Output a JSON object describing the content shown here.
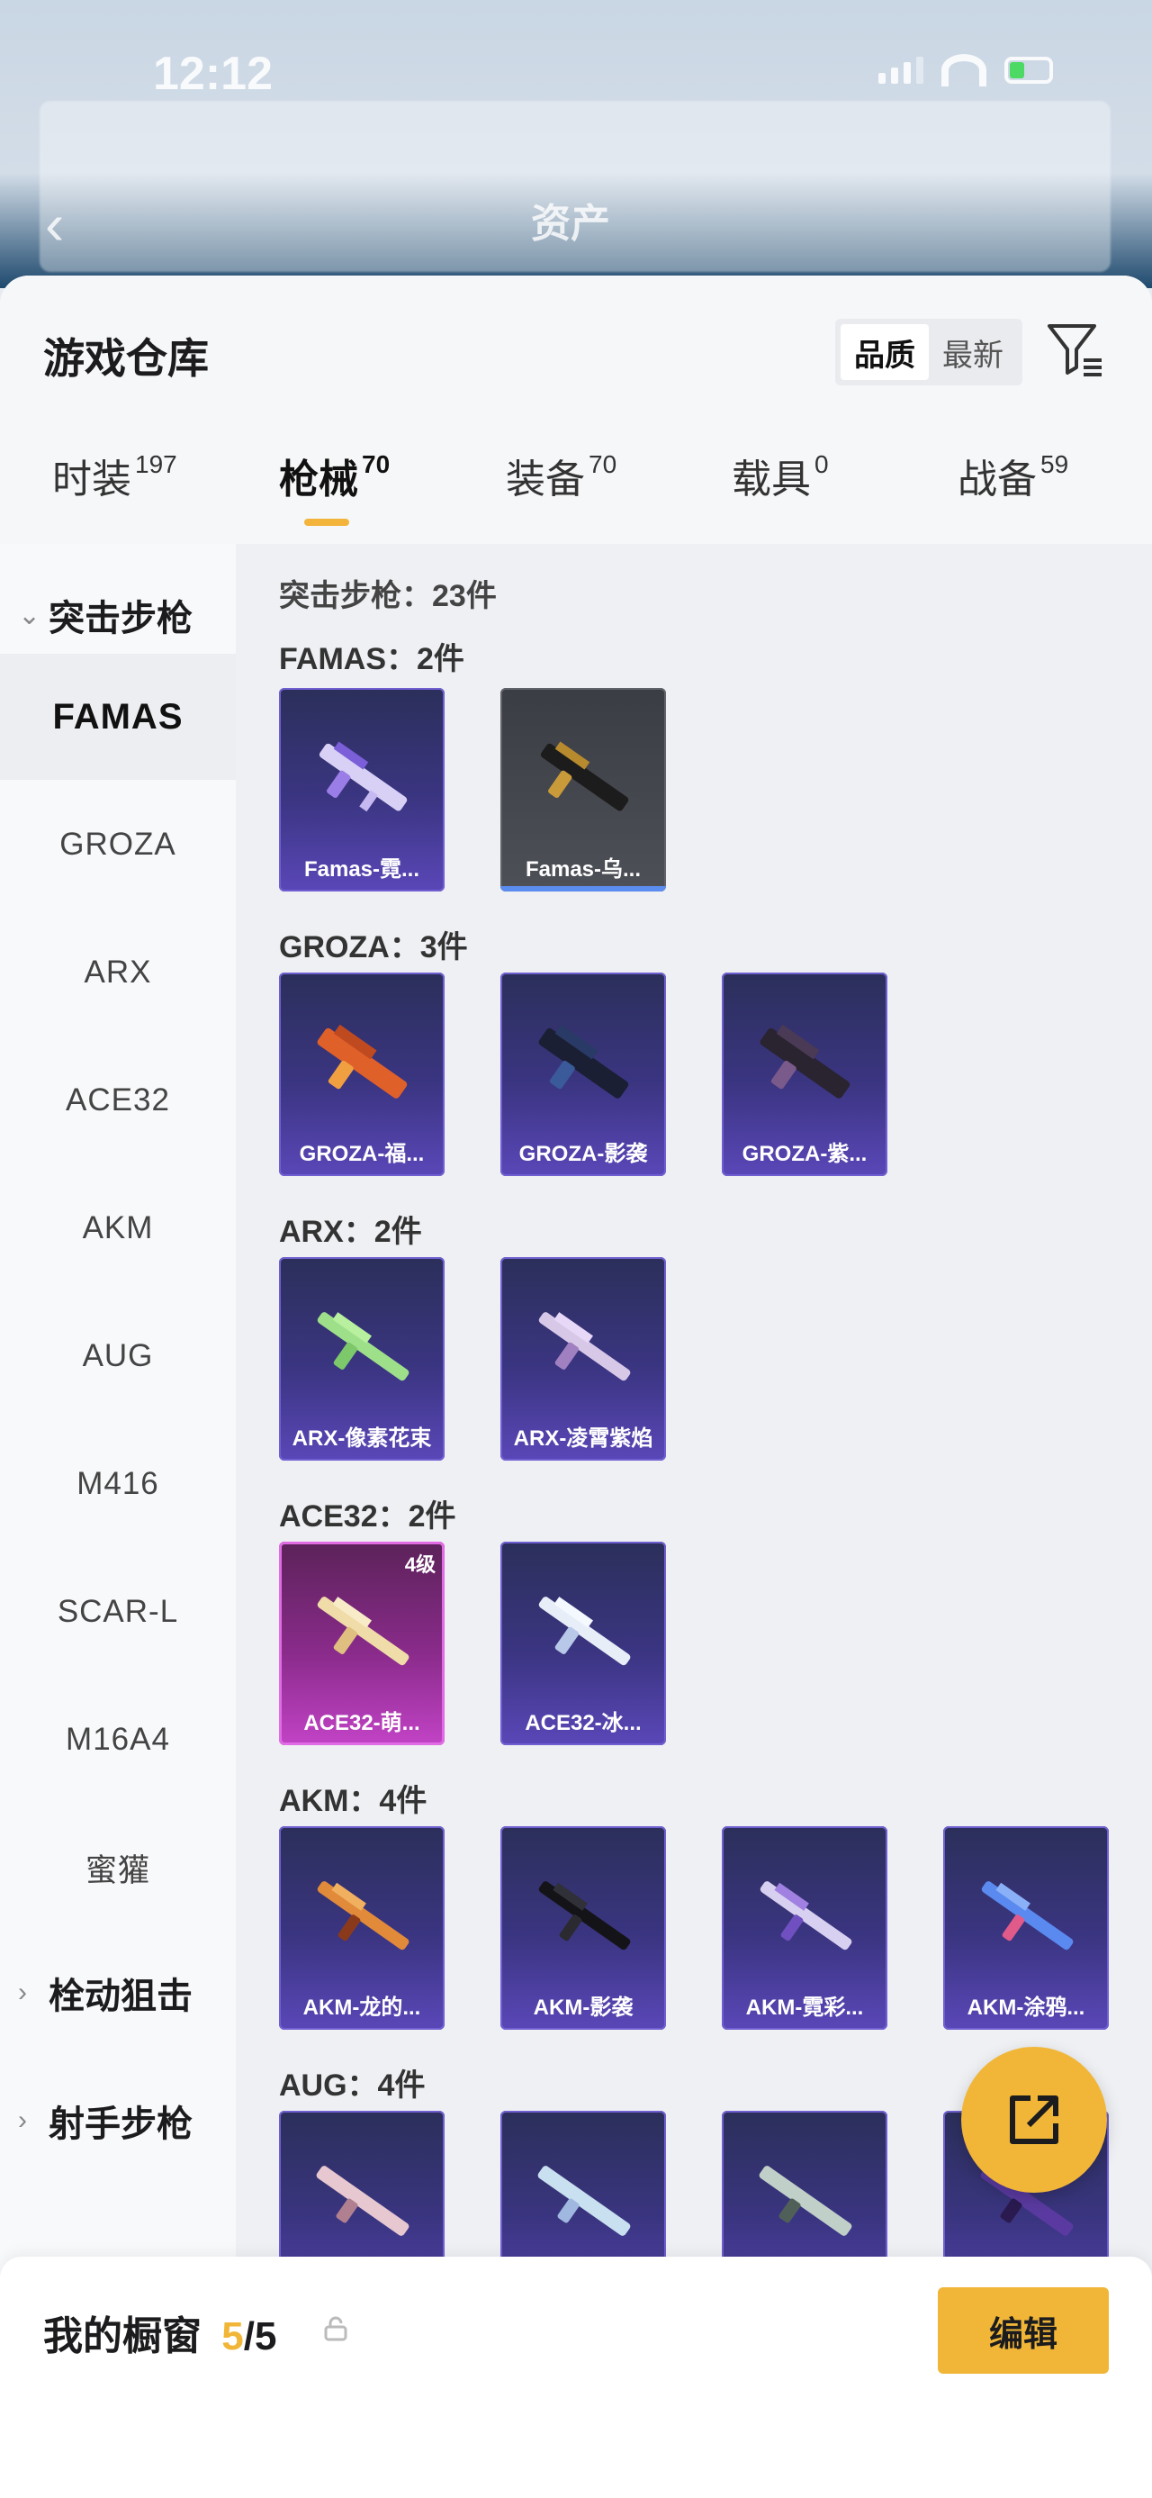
{
  "status_bar": {
    "time": "12:12"
  },
  "header": {
    "title": "资产"
  },
  "sheet": {
    "title": "游戏仓库",
    "sort": {
      "quality": "品质",
      "newest": "最新",
      "active": "quality"
    }
  },
  "tabs": [
    {
      "label": "时装",
      "count": "197"
    },
    {
      "label": "枪械",
      "count": "70",
      "active": true
    },
    {
      "label": "装备",
      "count": "70"
    },
    {
      "label": "载具",
      "count": "0"
    },
    {
      "label": "战备",
      "count": "59"
    }
  ],
  "sidebar": {
    "group_assault": "突击步枪",
    "items": [
      "FAMAS",
      "GROZA",
      "ARX",
      "ACE32",
      "AKM",
      "AUG",
      "M416",
      "SCAR-L",
      "M16A4",
      "蜜獾"
    ],
    "active_item": "FAMAS",
    "group_bolt": "栓动狙击",
    "group_marksman": "射手步枪"
  },
  "content": {
    "header": "突击步枪：23件",
    "sections": [
      {
        "title": "FAMAS：2件",
        "cards": [
          {
            "label": "Famas-霓...",
            "style": "purple"
          },
          {
            "label": "Famas-乌...",
            "style": "gray"
          }
        ]
      },
      {
        "title": "GROZA：3件",
        "cards": [
          {
            "label": "GROZA-福...",
            "style": "purple"
          },
          {
            "label": "GROZA-影袭",
            "style": "purple"
          },
          {
            "label": "GROZA-紫...",
            "style": "purple"
          }
        ]
      },
      {
        "title": "ARX：2件",
        "cards": [
          {
            "label": "ARX-像素花束",
            "style": "purple"
          },
          {
            "label": "ARX-凌霄紫焰",
            "style": "purple"
          }
        ]
      },
      {
        "title": "ACE32：2件",
        "cards": [
          {
            "label": "ACE32-萌...",
            "style": "pink",
            "badge": "4级"
          },
          {
            "label": "ACE32-冰...",
            "style": "purple"
          }
        ]
      },
      {
        "title": "AKM：4件",
        "cards": [
          {
            "label": "AKM-龙的...",
            "style": "purple"
          },
          {
            "label": "AKM-影袭",
            "style": "purple"
          },
          {
            "label": "AKM-霓彩...",
            "style": "purple"
          },
          {
            "label": "AKM-涂鸦...",
            "style": "purple"
          }
        ]
      },
      {
        "title": "AUG：4件",
        "cards": []
      }
    ]
  },
  "bottom_bar": {
    "title": "我的橱窗",
    "count_current": "5",
    "count_sep_total": "/5",
    "edit_label": "编辑"
  },
  "colors": {
    "accent": "#f1b638",
    "card_purple": "#3b3582",
    "card_pink": "#c243c6"
  },
  "icons": [
    "back-arrow-icon",
    "filter-icon",
    "chevron-down-icon",
    "chevron-right-icon",
    "share-icon",
    "lock-icon",
    "gun-icon"
  ]
}
